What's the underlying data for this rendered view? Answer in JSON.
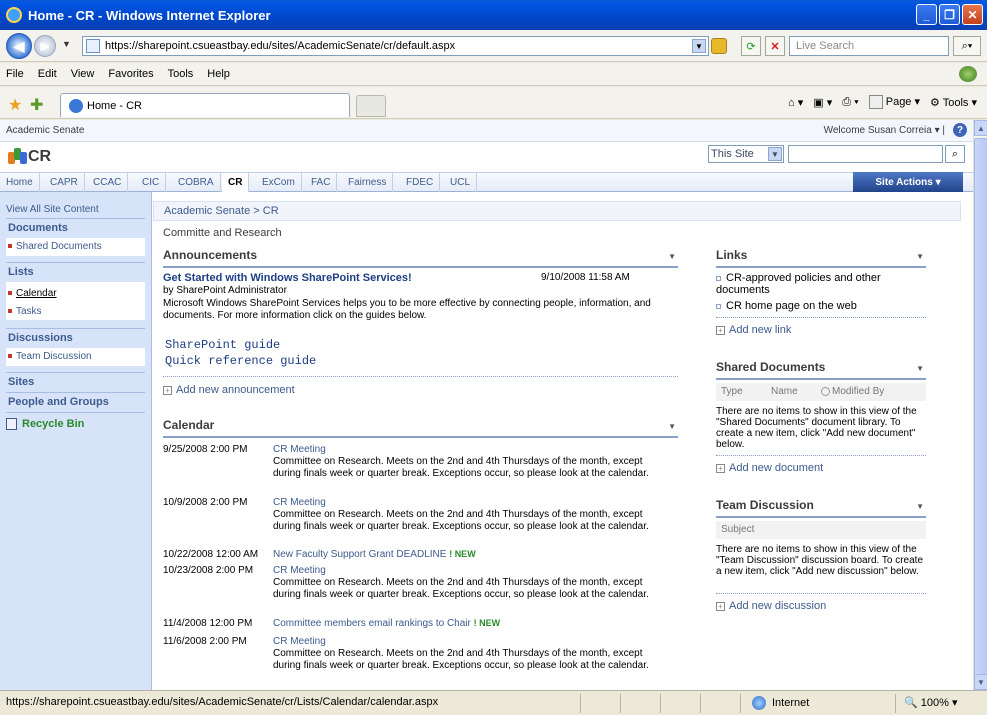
{
  "browser": {
    "window_title": "Home - CR - Windows Internet Explorer",
    "url": "https://sharepoint.csueastbay.edu/sites/AcademicSenate/cr/default.aspx",
    "search_placeholder": "Live Search",
    "menu": [
      "File",
      "Edit",
      "View",
      "Favorites",
      "Tools",
      "Help"
    ],
    "tab_label": "Home - CR",
    "cmd_page": "Page",
    "cmd_tools": "Tools",
    "status_url": "https://sharepoint.csueastbay.edu/sites/AcademicSenate/cr/Lists/Calendar/calendar.aspx",
    "status_zone": "Internet",
    "status_zoom": "100%"
  },
  "sp": {
    "parent_site": "Academic Senate",
    "welcome": "Welcome Susan Correia",
    "site_title": "CR",
    "search_scope": "This Site",
    "site_actions": "Site Actions",
    "nav_tabs": [
      "Home",
      "CAPR",
      "CCAC",
      "CIC",
      "COBRA",
      "CR",
      "ExCom",
      "FAC",
      "Fairness",
      "FDEC",
      "UCL"
    ],
    "selected_tab": "CR"
  },
  "leftnav": {
    "view_all": "View All Site Content",
    "documents_head": "Documents",
    "shared_docs": "Shared Documents",
    "lists_head": "Lists",
    "calendar": "Calendar",
    "tasks": "Tasks",
    "discussions_head": "Discussions",
    "team_discussion": "Team Discussion",
    "sites_head": "Sites",
    "people_head": "People and Groups",
    "recycle_bin": "Recycle Bin"
  },
  "main": {
    "breadcrumb": "Academic Senate > CR",
    "page_desc": "Committe and Research",
    "announcements": {
      "title": "Announcements",
      "item_title": "Get Started with Windows SharePoint Services!",
      "item_date": "9/10/2008 11:58 AM",
      "item_by": "by SharePoint Administrator",
      "item_body": "Microsoft Windows SharePoint Services helps you to be more effective by connecting people, information, and documents. For more information click on the guides below.",
      "guide1": "SharePoint guide",
      "guide2": "Quick reference guide",
      "add": "Add new announcement"
    },
    "calendar": {
      "title": "Calendar",
      "desc": "Committee on Research.  Meets on the 2nd and 4th Thursdays of the month, except during finals week or quarter break.  Exceptions occur, so please look at the calendar.",
      "new_flag": "NEW",
      "items": [
        {
          "date": "9/25/2008 2:00 PM",
          "title": "CR Meeting"
        },
        {
          "date": "10/9/2008 2:00 PM",
          "title": "CR Meeting"
        },
        {
          "date": "10/22/2008 12:00 AM",
          "title": "New Faculty Support Grant DEADLINE"
        },
        {
          "date": "10/23/2008 2:00 PM",
          "title": "CR Meeting"
        },
        {
          "date": "11/4/2008 12:00 PM",
          "title": "Committee members email rankings to Chair"
        },
        {
          "date": "11/6/2008 2:00 PM",
          "title": "CR Meeting"
        }
      ]
    }
  },
  "right": {
    "links_title": "Links",
    "link1": "CR-approved policies and other documents",
    "link2": "CR home page on the web",
    "add_link": "Add new link",
    "shared_title": "Shared Documents",
    "col_type": "Type",
    "col_name": "Name",
    "col_modified": "Modified By",
    "shared_empty": "There are no items to show in this view of the \"Shared Documents\" document library. To create a new item, click \"Add new document\" below.",
    "add_doc": "Add new document",
    "team_title": "Team Discussion",
    "col_subject": "Subject",
    "team_empty": "There are no items to show in this view of the \"Team Discussion\" discussion board. To create a new item, click \"Add new discussion\" below.",
    "add_disc": "Add new discussion"
  }
}
